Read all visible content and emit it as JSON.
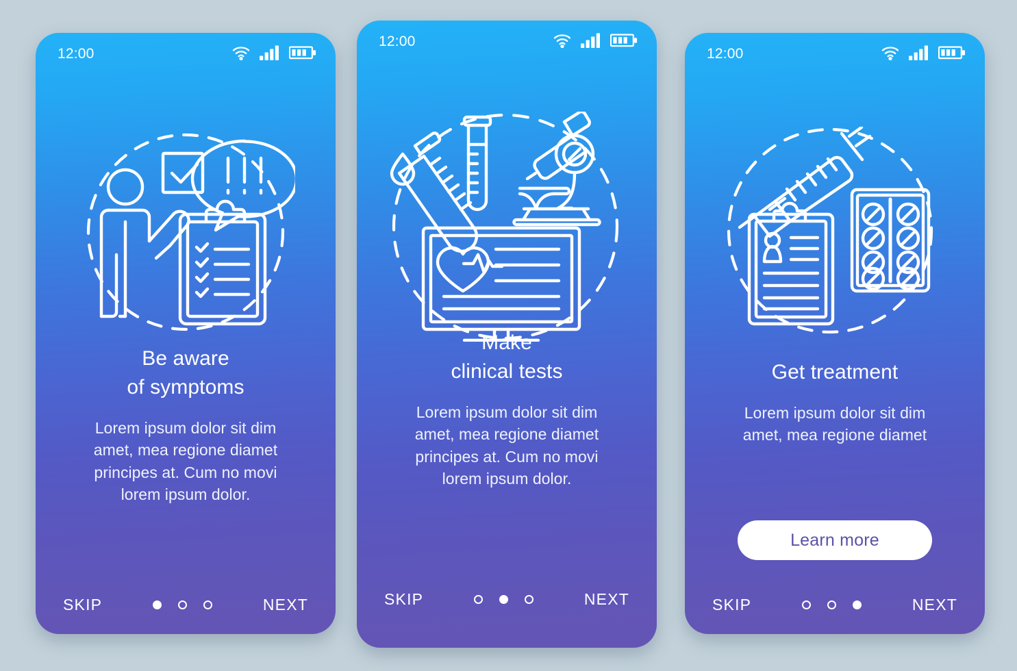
{
  "background_color": "#c3d2da",
  "theme": {
    "gradient_top": "#23b2f7",
    "gradient_bottom": "#6455b4",
    "text_color": "#ffffff",
    "cta_text_color": "#5a52a6",
    "cta_bg_color": "#ffffff"
  },
  "screens": [
    {
      "id": "be-aware-of-symptoms",
      "status_bar": {
        "time": "12:00",
        "icons": [
          "wifi-icon",
          "signal-icon",
          "battery-icon"
        ]
      },
      "illustration": {
        "name": "symptoms-awareness-illustration",
        "elements": [
          "person-icon",
          "checkbox-checked-icon",
          "speech-bubble-exclamation-icon",
          "clipboard-checklist-icon",
          "dashed-circle"
        ]
      },
      "headline": "Be aware\nof symptoms",
      "body": "Lorem ipsum dolor sit dim\namet, mea regione diamet\nprincipes at. Cum no movi\nlorem ipsum dolor.",
      "cta": null,
      "footer": {
        "skip_label": "SKIP",
        "next_label": "NEXT",
        "dots_total": 3,
        "dot_active_index": 0
      }
    },
    {
      "id": "make-clinical-tests",
      "status_bar": {
        "time": "12:00",
        "icons": [
          "wifi-icon",
          "signal-icon",
          "battery-icon"
        ]
      },
      "illustration": {
        "name": "clinical-tests-illustration",
        "elements": [
          "test-tube-tilted-icon",
          "blood-drop-icon",
          "test-tube-icon",
          "microscope-icon",
          "monitor-heartbeat-icon",
          "dashed-circle"
        ]
      },
      "headline": "Make\nclinical tests",
      "body": "Lorem ipsum dolor sit dim\namet, mea regione diamet\nprincipes at. Cum no movi\nlorem ipsum dolor.",
      "cta": null,
      "footer": {
        "skip_label": "SKIP",
        "next_label": "NEXT",
        "dots_total": 3,
        "dot_active_index": 1
      }
    },
    {
      "id": "get-treatment",
      "status_bar": {
        "time": "12:00",
        "icons": [
          "wifi-icon",
          "signal-icon",
          "battery-icon"
        ]
      },
      "illustration": {
        "name": "treatment-illustration",
        "elements": [
          "syringe-icon",
          "prescription-clipboard-icon",
          "pill-blister-pack-icon",
          "dashed-circle"
        ]
      },
      "headline": "Get treatment",
      "body": "Lorem ipsum dolor sit dim\namet, mea regione diamet",
      "cta": "Learn more",
      "footer": {
        "skip_label": "SKIP",
        "next_label": "NEXT",
        "dots_total": 3,
        "dot_active_index": 2
      }
    }
  ]
}
